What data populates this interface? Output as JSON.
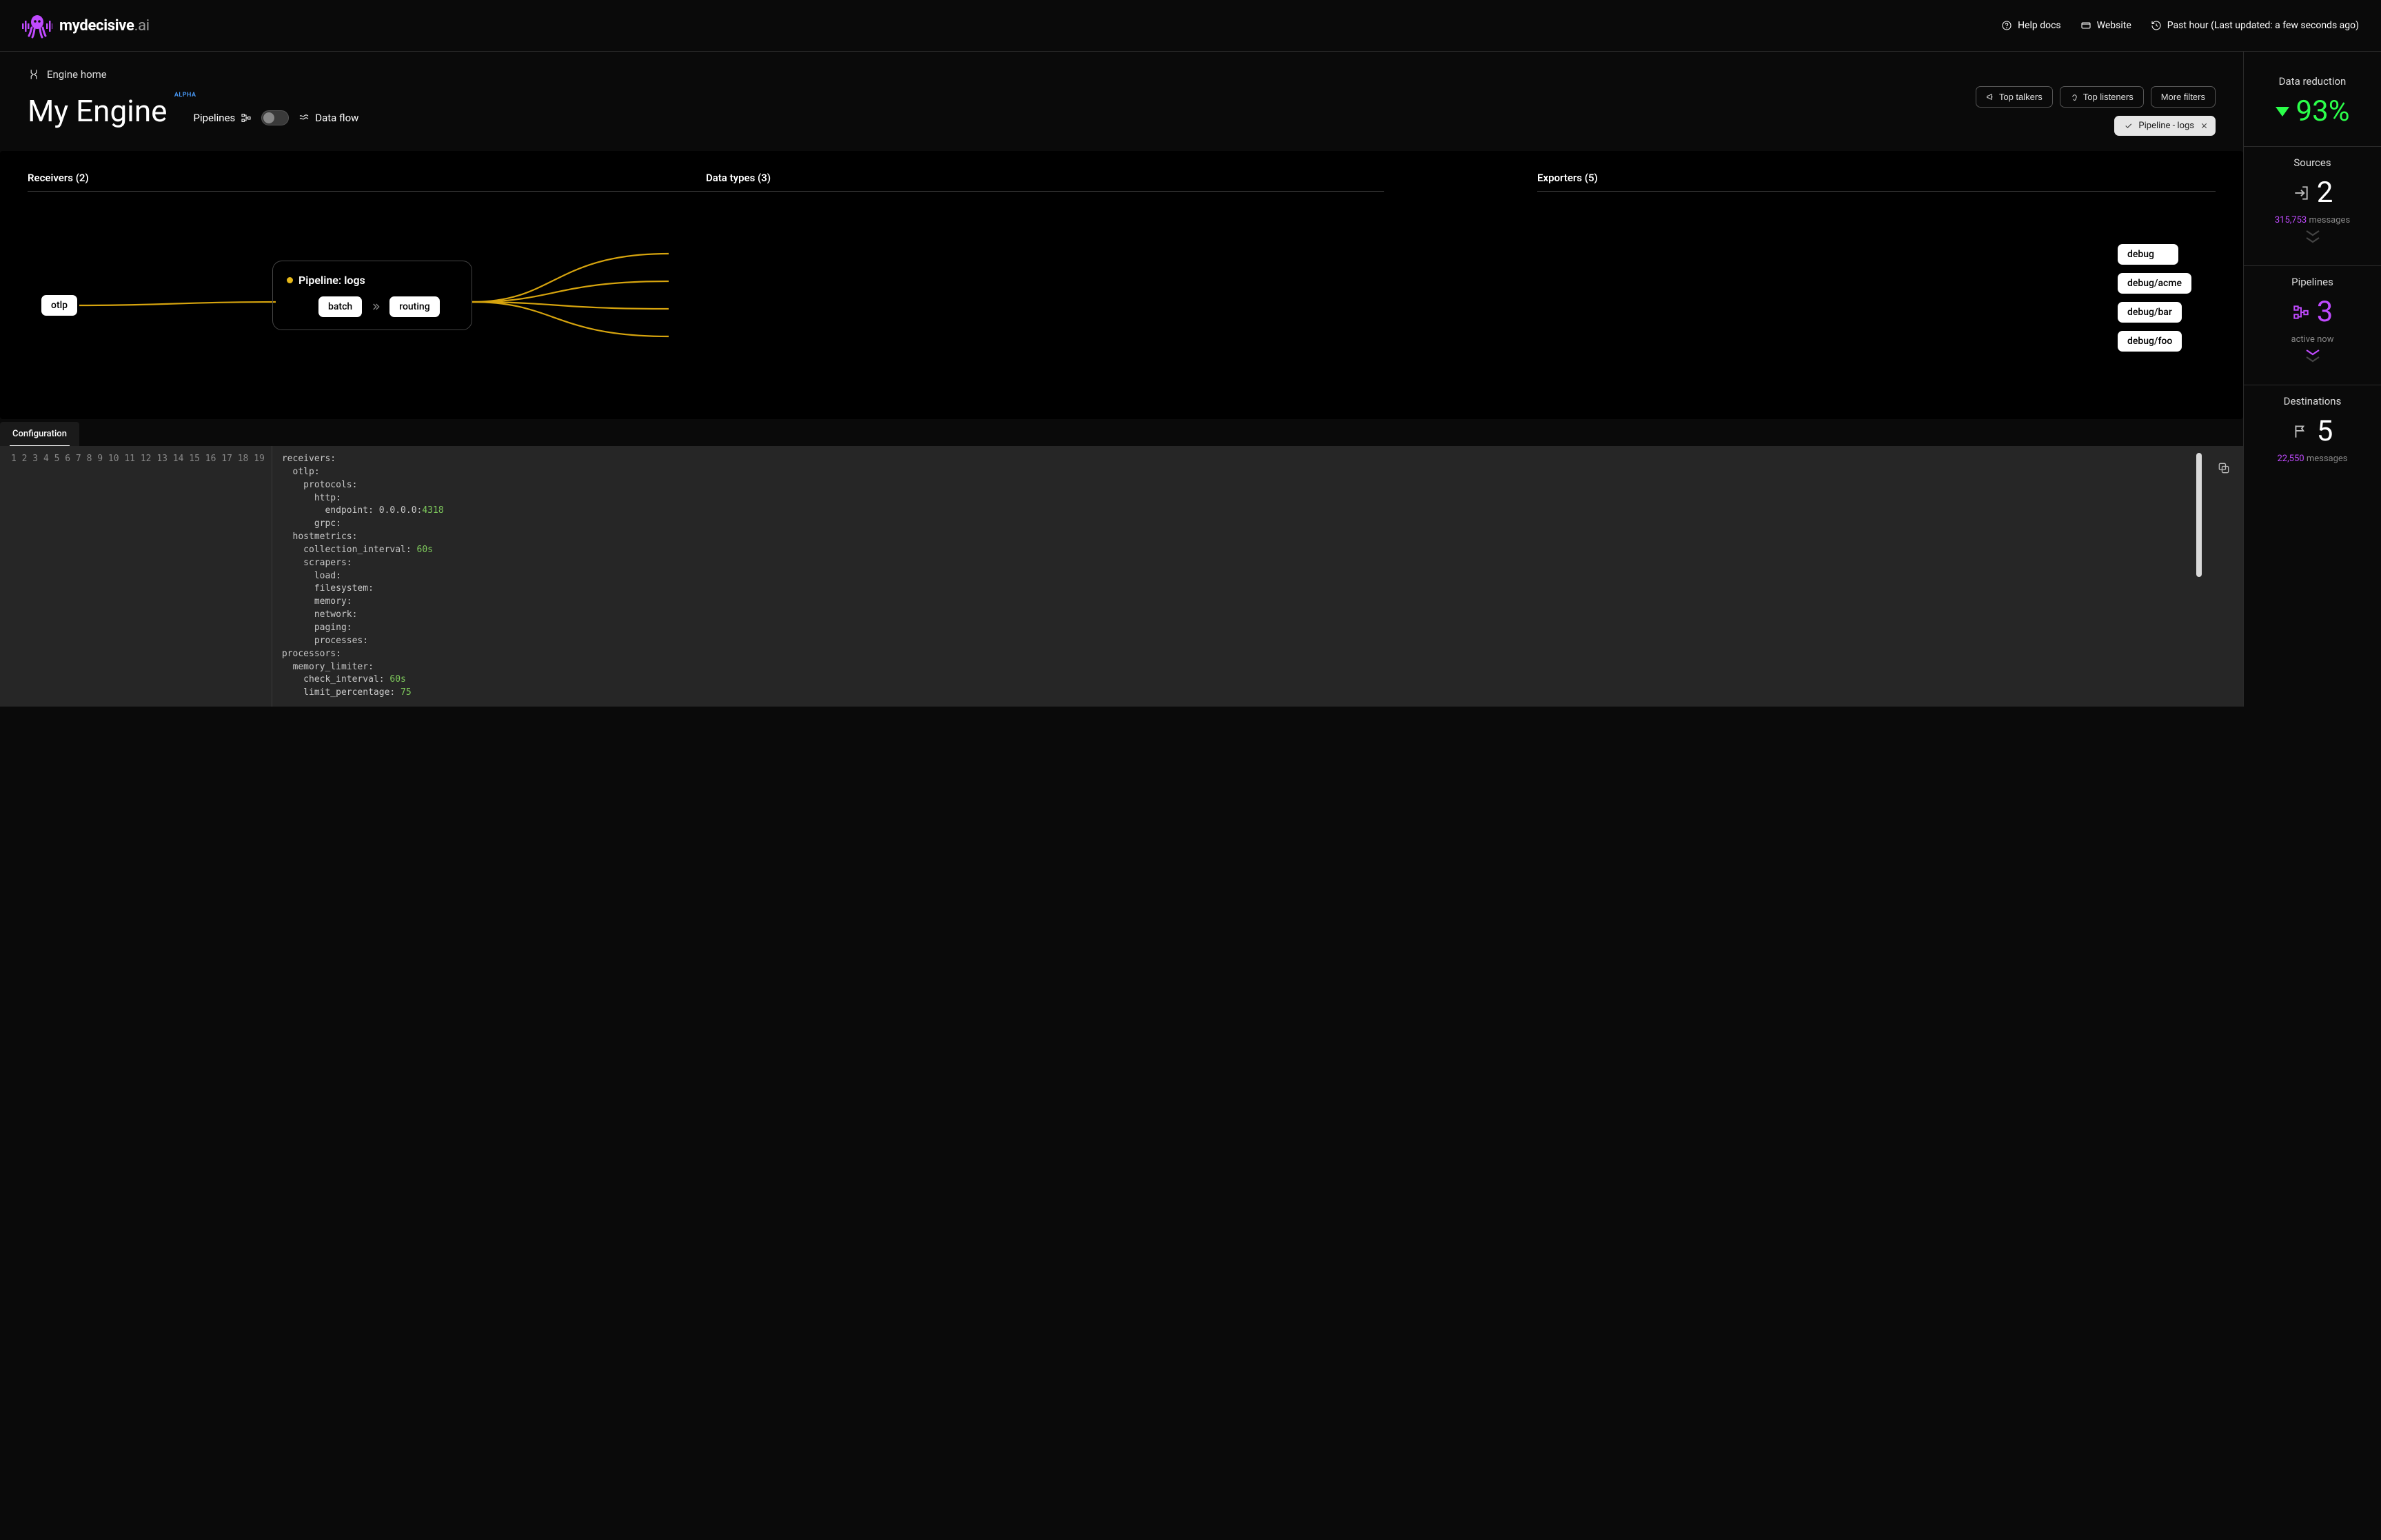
{
  "brand": {
    "name_bold": "mydecisive",
    "name_light": ".ai"
  },
  "header": {
    "help_docs": "Help docs",
    "website": "Website",
    "time_status": "Past hour (Last updated: a few seconds ago)"
  },
  "breadcrumb": {
    "engine_home": "Engine home"
  },
  "page": {
    "title": "My Engine",
    "alpha": "ALPHA",
    "pipelines_label": "Pipelines",
    "dataflow_label": "Data flow"
  },
  "filters": {
    "top_talkers": "Top talkers",
    "top_listeners": "Top listeners",
    "more_filters": "More filters",
    "active_chip": "Pipeline - logs"
  },
  "graph": {
    "receivers_header": "Receivers (2)",
    "datatypes_header": "Data types (3)",
    "exporters_header": "Exporters (5)",
    "receiver": "otlp",
    "pipeline_title": "Pipeline: logs",
    "processors": {
      "p1": "batch",
      "p2": "routing"
    },
    "exporters": [
      "debug",
      "debug/acme",
      "debug/bar",
      "debug/foo"
    ]
  },
  "config": {
    "tab": "Configuration",
    "code_lines": [
      "receivers:",
      "  otlp:",
      "    protocols:",
      "      http:",
      "        endpoint: 0.0.0.0:4318",
      "      grpc:",
      "  hostmetrics:",
      "    collection_interval: 60s",
      "    scrapers:",
      "      load:",
      "      filesystem:",
      "      memory:",
      "      network:",
      "      paging:",
      "      processes:",
      "processors:",
      "  memory_limiter:",
      "    check_interval: 60s",
      "    limit_percentage: 75"
    ],
    "highlight_tokens": [
      "4318",
      "60s",
      "60s",
      "75"
    ]
  },
  "side": {
    "data_reduction_title": "Data reduction",
    "data_reduction_value": "93%",
    "sources_title": "Sources",
    "sources_value": "2",
    "sources_sub_count": "315,753",
    "sources_sub_unit": "messages",
    "pipelines_title": "Pipelines",
    "pipelines_value": "3",
    "pipelines_sub": "active now",
    "destinations_title": "Destinations",
    "destinations_value": "5",
    "destinations_sub_count": "22,550",
    "destinations_sub_unit": "messages"
  }
}
